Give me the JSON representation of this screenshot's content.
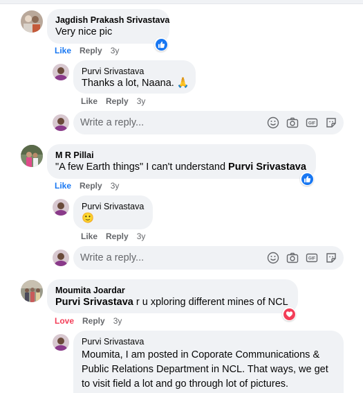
{
  "comments": [
    {
      "author": "Jagdish Prakash Srivastava",
      "text": "Very nice pic",
      "actions": {
        "like": "Like",
        "reply": "Reply",
        "time": "3y"
      },
      "reaction": "like",
      "replies": [
        {
          "author": "Purvi Srivastava",
          "text": "Thanks a lot, Naana. 🙏",
          "actions": {
            "like": "Like",
            "reply": "Reply",
            "time": "3y"
          }
        }
      ],
      "reply_box": {
        "placeholder": "Write a reply..."
      }
    },
    {
      "author": "M R Pillai",
      "text": "\"A few Earth things\" I can't understand ",
      "mention": "Purvi Srivastava",
      "actions": {
        "like": "Like",
        "reply": "Reply",
        "time": "3y"
      },
      "reaction": "like",
      "replies": [
        {
          "author": "Purvi Srivastava",
          "text": "🙂",
          "actions": {
            "like": "Like",
            "reply": "Reply",
            "time": "3y"
          }
        }
      ],
      "reply_box": {
        "placeholder": "Write a reply..."
      }
    },
    {
      "author": "Moumita Joardar",
      "mention": "Purvi Srivastava",
      "text": " r u xploring different mines of NCL",
      "actions": {
        "like": "Love",
        "reply": "Reply",
        "time": "3y"
      },
      "reaction": "love",
      "replies": [
        {
          "author": "Purvi Srivastava",
          "text": "Moumita, I am posted in Coporate Communications & Public Relations Department in NCL. That ways, we get to visit field a lot and go through lot of pictures. Sometimes, visuals are too"
        }
      ]
    }
  ],
  "reply_tools": [
    "smiley-icon",
    "camera-icon",
    "gif-icon",
    "sticker-icon"
  ],
  "colors": {
    "bubble": "#f0f2f5",
    "link_blue": "#1877f2",
    "love_red": "#f33e58",
    "meta_gray": "#65676b"
  }
}
